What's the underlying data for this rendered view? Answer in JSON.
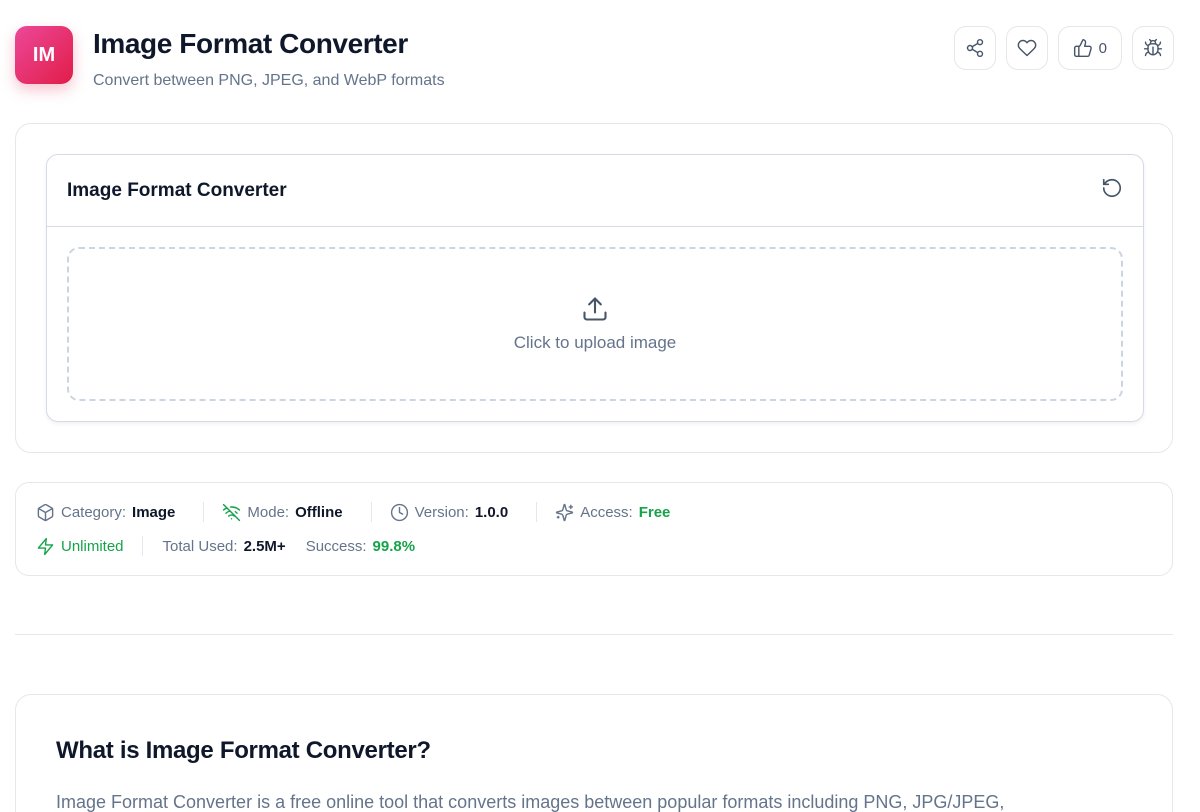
{
  "header": {
    "icon_text": "IM",
    "title": "Image Format Converter",
    "subtitle": "Convert between PNG, JPEG, and WebP formats",
    "like_count": "0",
    "icon_color": "#e11d48"
  },
  "actions": [
    {
      "icon": "share-icon"
    },
    {
      "icon": "heart-icon"
    },
    {
      "icon": "thumbs-up-icon"
    },
    {
      "icon": "bug-icon"
    }
  ],
  "tool": {
    "title": "Image Format Converter",
    "upload_text": "Click to upload image"
  },
  "meta": {
    "category_label": "Category:",
    "category_value": "Image",
    "mode_label": "Mode:",
    "mode_value": "Offline",
    "version_label": "Version:",
    "version_value": "1.0.0",
    "access_label": "Access:",
    "access_value": "Free",
    "unlimited": "Unlimited",
    "total_used_label": "Total Used:",
    "total_used_value": "2.5M+",
    "success_label": "Success:",
    "success_value": "99.8%",
    "accent_green": "#16a34a"
  },
  "about": {
    "title": "What is Image Format Converter?",
    "text": "Image Format Converter is a free online tool that converts images between popular formats including PNG, JPG/JPEG,"
  }
}
